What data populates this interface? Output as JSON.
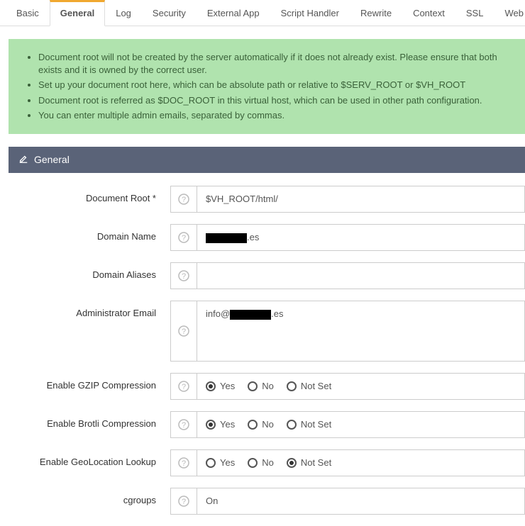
{
  "tabs": {
    "items": [
      "Basic",
      "General",
      "Log",
      "Security",
      "External App",
      "Script Handler",
      "Rewrite",
      "Context",
      "SSL",
      "Web Socket Pr"
    ],
    "active": "General"
  },
  "notice": {
    "items": [
      "Document root will not be created by the server automatically if it does not already exist. Please ensure that both exists and it is owned by the correct user.",
      "Set up your document root here, which can be absolute path or relative to $SERV_ROOT or $VH_ROOT",
      "Document root is referred as $DOC_ROOT in this virtual host, which can be used in other path configuration.",
      "You can enter multiple admin emails, separated by commas."
    ]
  },
  "panel": {
    "title": "General"
  },
  "form": {
    "docroot": {
      "label": "Document Root *",
      "value": "$VH_ROOT/html/"
    },
    "domain": {
      "label": "Domain Name",
      "value_suffix": ".es"
    },
    "aliases": {
      "label": "Domain Aliases",
      "value": ""
    },
    "admin_email": {
      "label": "Administrator Email",
      "value_prefix": "info@",
      "value_suffix": ".es"
    },
    "gzip": {
      "label": "Enable GZIP Compression",
      "selected": "Yes"
    },
    "brotli": {
      "label": "Enable Brotli Compression",
      "selected": "Yes"
    },
    "geo": {
      "label": "Enable GeoLocation Lookup",
      "selected": "Not Set"
    },
    "cgroups": {
      "label": "cgroups",
      "value": "On"
    },
    "radio_options": [
      "Yes",
      "No",
      "Not Set"
    ]
  }
}
